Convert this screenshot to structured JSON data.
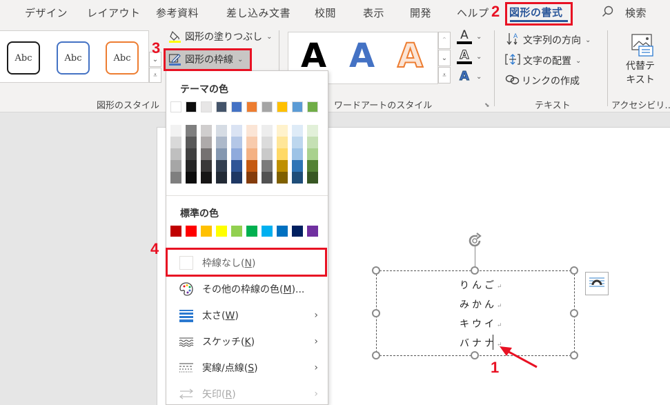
{
  "tabs": [
    {
      "label": "デザイン"
    },
    {
      "label": "レイアウト"
    },
    {
      "label": "参考資料"
    },
    {
      "label": "差し込み文書"
    },
    {
      "label": "校閲"
    },
    {
      "label": "表示"
    },
    {
      "label": "開発"
    },
    {
      "label": "ヘルプ"
    },
    {
      "label": "図形の書式",
      "active": true
    }
  ],
  "search": {
    "label": "検索",
    "icon": "search-icon"
  },
  "ribbon": {
    "shape_styles": {
      "label": "図形のスタイル",
      "swatches": [
        {
          "text": "Abc",
          "border": "#1a1a1a"
        },
        {
          "text": "Abc",
          "border": "#4472c4"
        },
        {
          "text": "Abc",
          "border": "#ed7d31"
        }
      ],
      "fill_button": "図形の塗りつぶし",
      "outline_button": "図形の枠線",
      "effects_accent": "#ffff00"
    },
    "wordart_styles": {
      "label": "ワードアートのスタイル",
      "letters": [
        {
          "text": "A",
          "color": "#000000"
        },
        {
          "text": "A",
          "color": "#4472c4"
        },
        {
          "text": "A",
          "color": "#f4b183"
        }
      ],
      "text_buttons": [
        "A",
        "A",
        "A"
      ]
    },
    "text": {
      "label": "テキスト",
      "direction": "文字列の方向",
      "align": "文字の配置",
      "link": "リンクの作成"
    },
    "accessibility": {
      "label": "アクセシビリ…",
      "alt_text_line1": "代替テ",
      "alt_text_line2": "キスト"
    }
  },
  "dropdown": {
    "theme_heading": "テーマの色",
    "theme_colors": [
      "#ffffff",
      "#0d0d0d",
      "#e7e6e6",
      "#44546a",
      "#4472c4",
      "#ed7d31",
      "#a5a5a5",
      "#ffc000",
      "#5b9bd5",
      "#70ad47"
    ],
    "theme_shades": [
      [
        "#f2f2f2",
        "#d9d9d9",
        "#bfbfbf",
        "#a6a6a6",
        "#7f7f7f"
      ],
      [
        "#7f7f7f",
        "#595959",
        "#404040",
        "#262626",
        "#0d0d0d"
      ],
      [
        "#d0cece",
        "#aeaaaa",
        "#757171",
        "#3a3838",
        "#171616"
      ],
      [
        "#d6dce4",
        "#adb9ca",
        "#8497b0",
        "#333f50",
        "#222a35"
      ],
      [
        "#dae3f3",
        "#b4c7e7",
        "#8faadc",
        "#2f5597",
        "#1f3864"
      ],
      [
        "#fbe5d6",
        "#f8cbad",
        "#f4b183",
        "#c55a11",
        "#843c0c"
      ],
      [
        "#ededed",
        "#dbdbdb",
        "#c9c9c9",
        "#7b7b7b",
        "#525252"
      ],
      [
        "#fff2cc",
        "#ffe699",
        "#ffd966",
        "#bf9000",
        "#7f6000"
      ],
      [
        "#deebf7",
        "#bdd7ee",
        "#9dc3e6",
        "#2e75b6",
        "#1f4e79"
      ],
      [
        "#e2f0d9",
        "#c5e0b4",
        "#a9d18e",
        "#548235",
        "#385723"
      ]
    ],
    "standard_heading": "標準の色",
    "standard_colors": [
      "#c00000",
      "#ff0000",
      "#ffc000",
      "#ffff00",
      "#92d050",
      "#00b050",
      "#00b0f0",
      "#0070c0",
      "#002060",
      "#7030a0"
    ],
    "items": [
      {
        "label": "枠線なし(",
        "key": "N",
        "suffix": ")",
        "icon": "no-outline-icon",
        "submenu": false,
        "disabled": false
      },
      {
        "label": "その他の枠線の色(",
        "key": "M",
        "suffix": ")...",
        "icon": "palette-icon",
        "submenu": false,
        "disabled": false
      },
      {
        "label": "太さ(",
        "key": "W",
        "suffix": ")",
        "icon": "line-weight-icon",
        "submenu": true,
        "disabled": false
      },
      {
        "label": "スケッチ(",
        "key": "K",
        "suffix": ")",
        "icon": "sketch-icon",
        "submenu": true,
        "disabled": false
      },
      {
        "label": "実線/点線(",
        "key": "S",
        "suffix": ")",
        "icon": "dashes-icon",
        "submenu": true,
        "disabled": false
      },
      {
        "label": "矢印(",
        "key": "R",
        "suffix": ")",
        "icon": "arrows-icon",
        "submenu": true,
        "disabled": true
      }
    ],
    "submenu_arrow": "›"
  },
  "shape": {
    "lines": [
      "りんご",
      "みかん",
      "キウイ",
      "バナナ"
    ],
    "return_mark": "↵"
  },
  "annotations": {
    "step1": "1",
    "step2": "2",
    "step3": "3",
    "step4": "4",
    "color": "#e81123"
  }
}
